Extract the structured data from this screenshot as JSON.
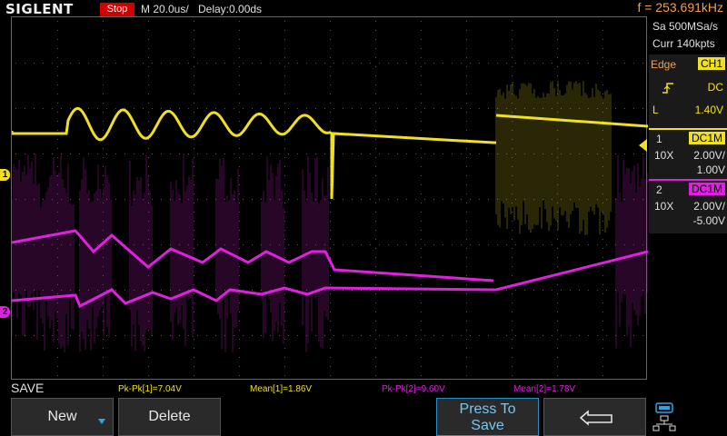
{
  "header": {
    "brand": "SIGLENT",
    "run_state": "Stop",
    "timebase": "M 20.0us/",
    "delay": "Delay:0.00ds",
    "frequency": "f = 253.691kHz"
  },
  "acquisition": {
    "sample_rate": "Sa 500MSa/s",
    "memory_depth": "Curr 140kpts"
  },
  "trigger": {
    "type": "Edge",
    "source": "CH1",
    "slope_icon": "rising-edge-icon",
    "coupling": "DC",
    "level_prefix": "L",
    "level": "1.40V"
  },
  "channels": [
    {
      "number": "1",
      "coupling": "DC1M",
      "probe": "10X",
      "scale": "2.00V/",
      "offset": "1.00V",
      "color": "#f0e020"
    },
    {
      "number": "2",
      "coupling": "DC1M",
      "probe": "10X",
      "scale": "2.00V/",
      "offset": "-5.00V",
      "color": "#e020e0"
    }
  ],
  "markers": {
    "ch1": "1",
    "ch2": "2"
  },
  "measurements": {
    "pkpk1": "Pk-Pk[1]=7.04V",
    "mean1": "Mean[1]=1.86V",
    "pkpk2": "Pk-Pk[2]=9.60V",
    "mean2": "Mean[2]=1.78V"
  },
  "menu": {
    "title": "SAVE",
    "softkeys": {
      "new": "New",
      "delete": "Delete",
      "press_to_save_line1": "Press To",
      "press_to_save_line2": "Save",
      "back_icon": "return-icon"
    }
  },
  "colors": {
    "ch1": "#f0e020",
    "ch2": "#e020e0",
    "accent": "#2aa6e8",
    "frequency": "#f0a050"
  }
}
